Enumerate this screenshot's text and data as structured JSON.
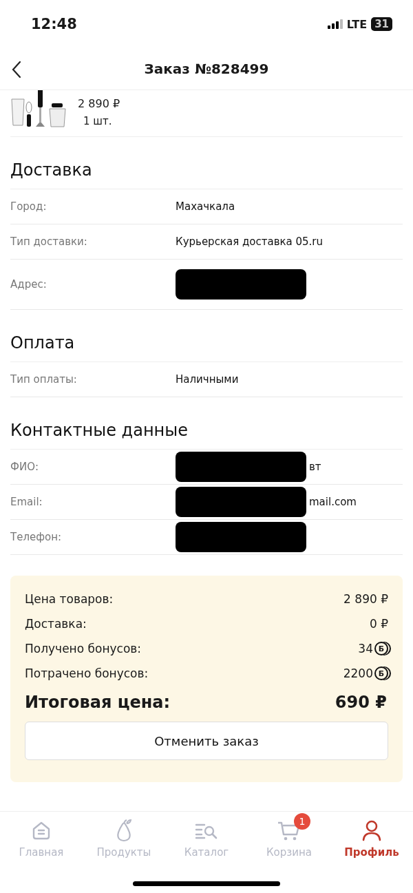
{
  "status_bar": {
    "time": "12:48",
    "network": "LTE",
    "battery": "31"
  },
  "header": {
    "title": "Заказ №828499"
  },
  "product": {
    "price": "2 890 ₽",
    "quantity": "1 шт."
  },
  "sections": [
    {
      "title": "Доставка",
      "rows": [
        {
          "label": "Город:",
          "value": "Махачкала",
          "redacted": false
        },
        {
          "label": "Тип доставки:",
          "value": "Курьерская доставка 05.ru",
          "redacted": false
        },
        {
          "label": "Адрес:",
          "value": "",
          "redacted": true
        }
      ]
    },
    {
      "title": "Оплата",
      "rows": [
        {
          "label": "Тип оплаты:",
          "value": "Наличными",
          "redacted": false
        }
      ]
    },
    {
      "title": "Контактные данные",
      "rows": [
        {
          "label": "ФИО:",
          "value": "вт",
          "redacted": true
        },
        {
          "label": "Email:",
          "value": "mail.com",
          "redacted": true
        },
        {
          "label": "Телефон:",
          "value": "",
          "redacted": true
        }
      ]
    }
  ],
  "summary": {
    "rows": [
      {
        "label": "Цена товаров:",
        "value": "2 890 ₽",
        "kind": "money"
      },
      {
        "label": "Доставка:",
        "value": "0 ₽",
        "kind": "money"
      },
      {
        "label": "Получено бонусов:",
        "value": "34",
        "kind": "bonus",
        "mark": "Б"
      },
      {
        "label": "Потрачено бонусов:",
        "value": "2200",
        "kind": "bonus",
        "mark": "Б"
      }
    ],
    "total_label": "Итоговая цена:",
    "total_value": "690 ₽",
    "cancel_button": "Отменить заказ"
  },
  "tab_bar": [
    {
      "label": "Главная",
      "selected": false
    },
    {
      "label": "Продукты",
      "selected": false
    },
    {
      "label": "Каталог",
      "selected": false
    },
    {
      "label": "Корзина",
      "selected": false,
      "badge": "1"
    },
    {
      "label": "Профиль",
      "selected": true
    }
  ]
}
